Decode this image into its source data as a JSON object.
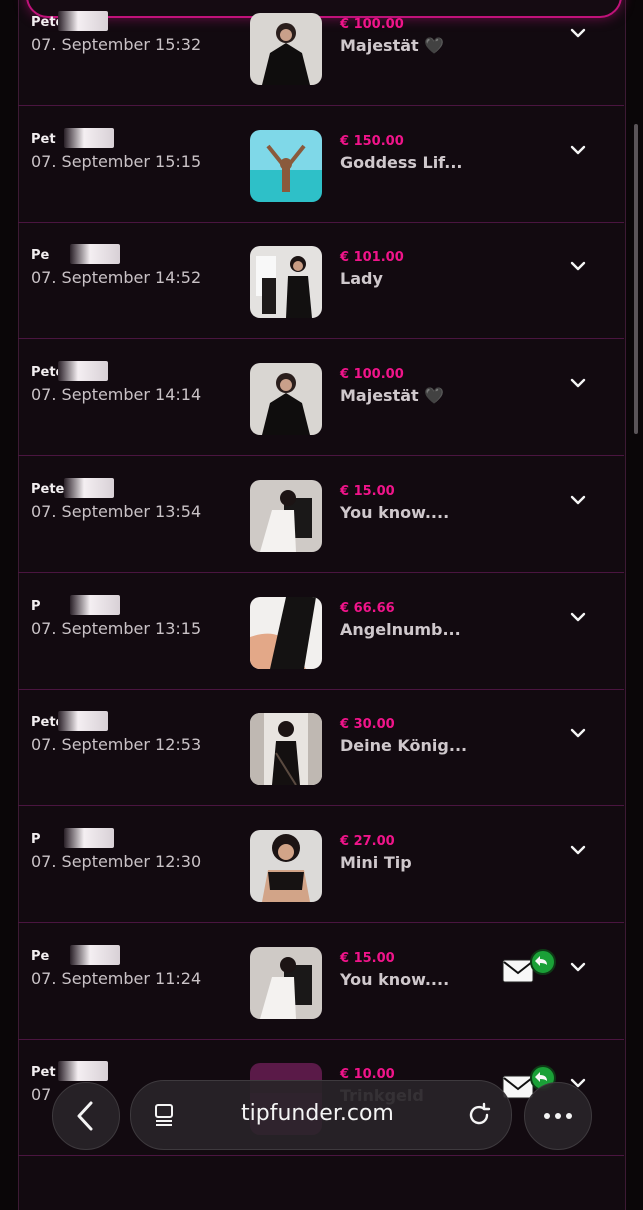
{
  "rows": [
    {
      "name": "Peterl",
      "date": "07. September 15:32",
      "amount": "€ 100.00",
      "title": "Majestät 🖤",
      "thumb": "t1"
    },
    {
      "name": "Pet",
      "date": "07. September 15:15",
      "amount": "€ 150.00",
      "title": "Goddess Lif...",
      "thumb": "t2"
    },
    {
      "name": "Pe",
      "date": "07. September 14:52",
      "amount": "€ 101.00",
      "title": "Lady",
      "thumb": "t3"
    },
    {
      "name": "Peter",
      "date": "07. September 14:14",
      "amount": "€ 100.00",
      "title": "Majestät 🖤",
      "thumb": "t1"
    },
    {
      "name": "Pete",
      "date": "07. September 13:54",
      "amount": "€ 15.00",
      "title": "You know....",
      "thumb": "t4"
    },
    {
      "name": "P",
      "date": "07. September 13:15",
      "amount": "€ 66.66",
      "title": "Angelnumb...",
      "thumb": "t5"
    },
    {
      "name": "Pete",
      "date": "07. September 12:53",
      "amount": "€ 30.00",
      "title": "Deine König...",
      "thumb": "t6"
    },
    {
      "name": "P",
      "date": "07. September 12:30",
      "amount": "€ 27.00",
      "title": "Mini Tip",
      "thumb": "t7"
    },
    {
      "name": "Pe",
      "date": "07. September 11:24",
      "amount": "€ 15.00",
      "title": "You know....",
      "thumb": "t4"
    },
    {
      "name": "Pet",
      "date": "07",
      "amount": "€ 10.00",
      "title": "Trinkgeld",
      "thumb": "t8"
    }
  ],
  "browser": {
    "url": "tipfunder.com"
  },
  "colors": {
    "accent": "#f0148a",
    "row_border": "#4a1540"
  },
  "icons": {
    "back": "chevron-left-icon",
    "tabs": "tabs-icon",
    "reload": "reload-icon",
    "more": "more-icon"
  }
}
